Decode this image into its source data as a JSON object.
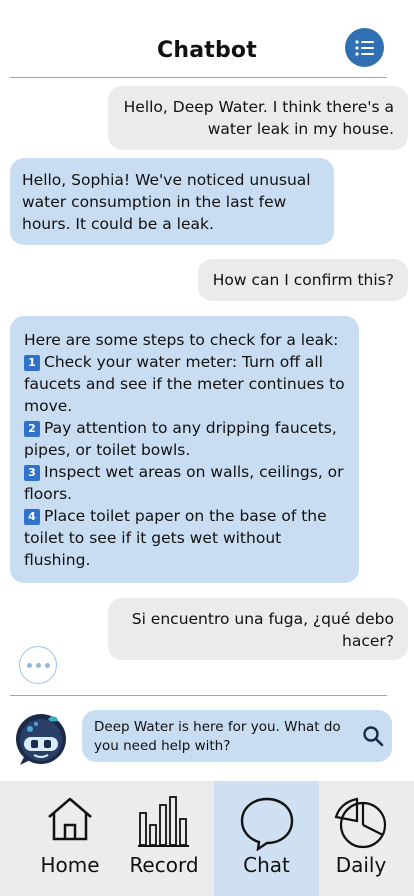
{
  "header": {
    "title": "Chatbot"
  },
  "messages": [
    {
      "role": "user",
      "text": "Hello, Deep Water. I think there's a water leak in my house."
    },
    {
      "role": "bot",
      "text": "Hello, Sophia! We've noticed unusual water consumption in the last few hours. It could be a leak."
    },
    {
      "role": "user",
      "text": "How can I confirm this?"
    },
    {
      "role": "bot",
      "intro": "Here are some steps to check for a leak:",
      "steps": [
        {
          "badge": "1",
          "text": "Check your water meter: Turn off all faucets and see if the meter continues to move."
        },
        {
          "badge": "2",
          "text": "Pay attention to any dripping faucets, pipes, or toilet bowls."
        },
        {
          "badge": "3",
          "text": "Inspect wet areas on walls, ceilings, or floors."
        },
        {
          "badge": "4",
          "text": "Place toilet paper on the base of the toilet to see if it gets wet without flushing."
        }
      ]
    },
    {
      "role": "user",
      "text": "Si encuentro una fuga, ¿qué debo hacer?"
    }
  ],
  "input": {
    "placeholder": "Deep Water is here for you. What do you need help with?"
  },
  "nav": [
    {
      "label": "Home",
      "icon": "home-icon"
    },
    {
      "label": "Record",
      "icon": "bar-chart-icon"
    },
    {
      "label": "Chat",
      "icon": "chat-bubble-icon",
      "active": true
    },
    {
      "label": "Daily",
      "icon": "pie-chart-icon"
    }
  ],
  "colors": {
    "accent": "#2f6fb2",
    "bot_bubble": "#c9ddf2",
    "user_bubble": "#ebebeb",
    "nav_active": "#cfe0f2"
  }
}
